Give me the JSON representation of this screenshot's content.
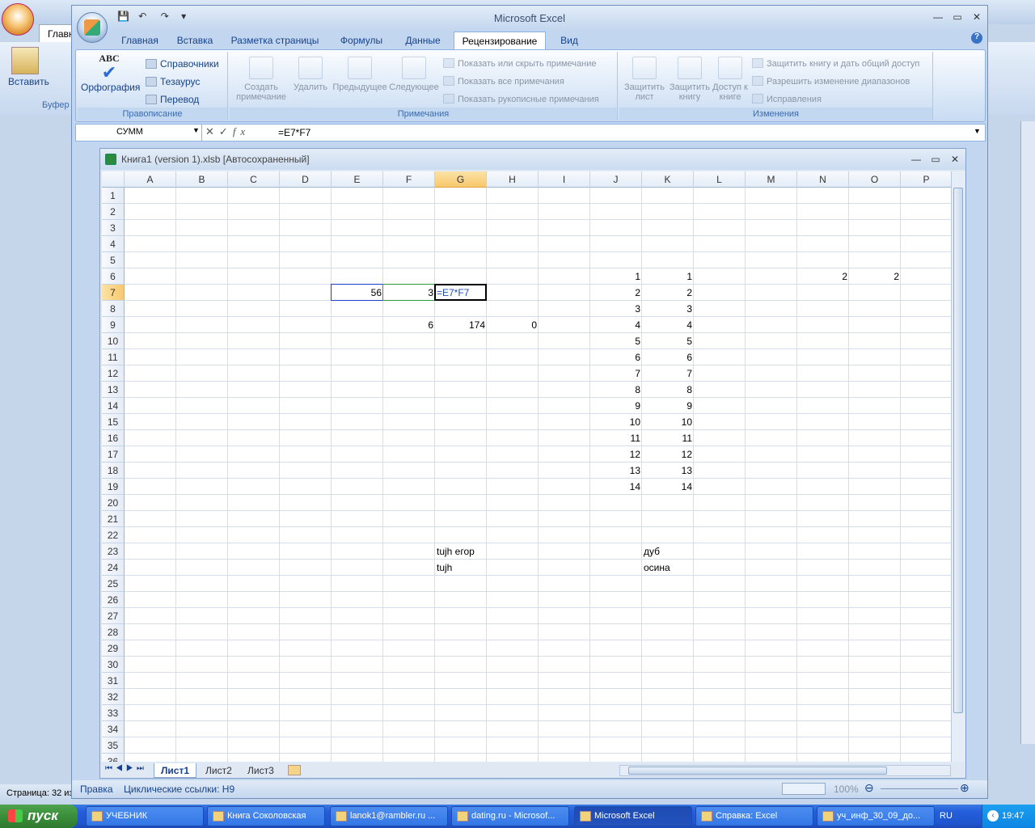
{
  "background_window": {
    "tab_label": "Главн",
    "clipboard_group": "Буфер",
    "paste_label": "Вставить",
    "status_text": "Страница: 32 из"
  },
  "window": {
    "title": "Microsoft Excel"
  },
  "quick_access": {
    "save": "💾",
    "undo": "↶",
    "redo": "↷"
  },
  "tabs": [
    "Главная",
    "Вставка",
    "Разметка страницы",
    "Формулы",
    "Данные",
    "Рецензирование",
    "Вид"
  ],
  "ribbon": {
    "proofing": {
      "label": "Правописание",
      "spelling": "Орфография",
      "research": "Справочники",
      "thesaurus": "Тезаурус",
      "translate": "Перевод"
    },
    "comments": {
      "label": "Примечания",
      "new": "Создать примечание",
      "delete": "Удалить",
      "previous": "Предыдущее",
      "next": "Следующее",
      "show_hide": "Показать или скрыть примечание",
      "show_all": "Показать все примечания",
      "show_ink": "Показать рукописные примечания"
    },
    "changes": {
      "label": "Изменения",
      "protect_sheet": "Защитить лист",
      "protect_workbook": "Защитить книгу",
      "share_workbook": "Доступ к книге",
      "protect_share": "Защитить книгу и дать общий доступ",
      "allow_ranges": "Разрешить изменение диапазонов",
      "track_changes": "Исправления"
    }
  },
  "formula_bar": {
    "name_box": "СУММ",
    "formula": "=E7*F7"
  },
  "workbook": {
    "title": "Книга1 (version 1).xlsb [Автосохраненный]"
  },
  "columns": [
    "A",
    "B",
    "C",
    "D",
    "E",
    "F",
    "G",
    "H",
    "I",
    "J",
    "K",
    "L",
    "M",
    "N",
    "O",
    "P"
  ],
  "rows": [
    "1",
    "2",
    "3",
    "4",
    "5",
    "6",
    "7",
    "8",
    "9",
    "10",
    "11",
    "12",
    "13",
    "14",
    "15",
    "16",
    "17",
    "18",
    "19",
    "20",
    "21",
    "22",
    "23",
    "24",
    "25",
    "26",
    "27",
    "28",
    "29",
    "30",
    "31",
    "32",
    "33",
    "34",
    "35",
    "36"
  ],
  "cells": {
    "N6": "2",
    "O6": "2",
    "E7": "56",
    "F7": "3",
    "G7": "=E7*F7",
    "F9": "6",
    "G9": "174",
    "H9": "0",
    "J6": "1",
    "K6": "1",
    "J7": "2",
    "K7": "2",
    "J8": "3",
    "K8": "3",
    "J9": "4",
    "K9": "4",
    "J10": "5",
    "K10": "5",
    "J11": "6",
    "K11": "6",
    "J12": "7",
    "K12": "7",
    "J13": "8",
    "K13": "8",
    "J14": "9",
    "K14": "9",
    "J15": "10",
    "K15": "10",
    "J16": "11",
    "K16": "11",
    "J17": "12",
    "K17": "12",
    "J18": "13",
    "K18": "13",
    "J19": "14",
    "K19": "14",
    "G23": "tujh егор",
    "G24": "tujh",
    "K23": "дуб",
    "K24": "осина"
  },
  "sheets": [
    "Лист1",
    "Лист2",
    "Лист3"
  ],
  "status_bar": {
    "mode": "Правка",
    "circular": "Циклические ссылки: H9",
    "zoom": "100%"
  },
  "taskbar": {
    "start": "пуск",
    "items": [
      "УЧЕБНИК",
      "Книга Соколовская",
      "lanok1@rambler.ru ...",
      "dating.ru - Microsof...",
      "Microsoft Excel",
      "Справка: Excel",
      "уч_инф_30_09_до..."
    ],
    "lang": "RU",
    "clock": "19:47"
  }
}
